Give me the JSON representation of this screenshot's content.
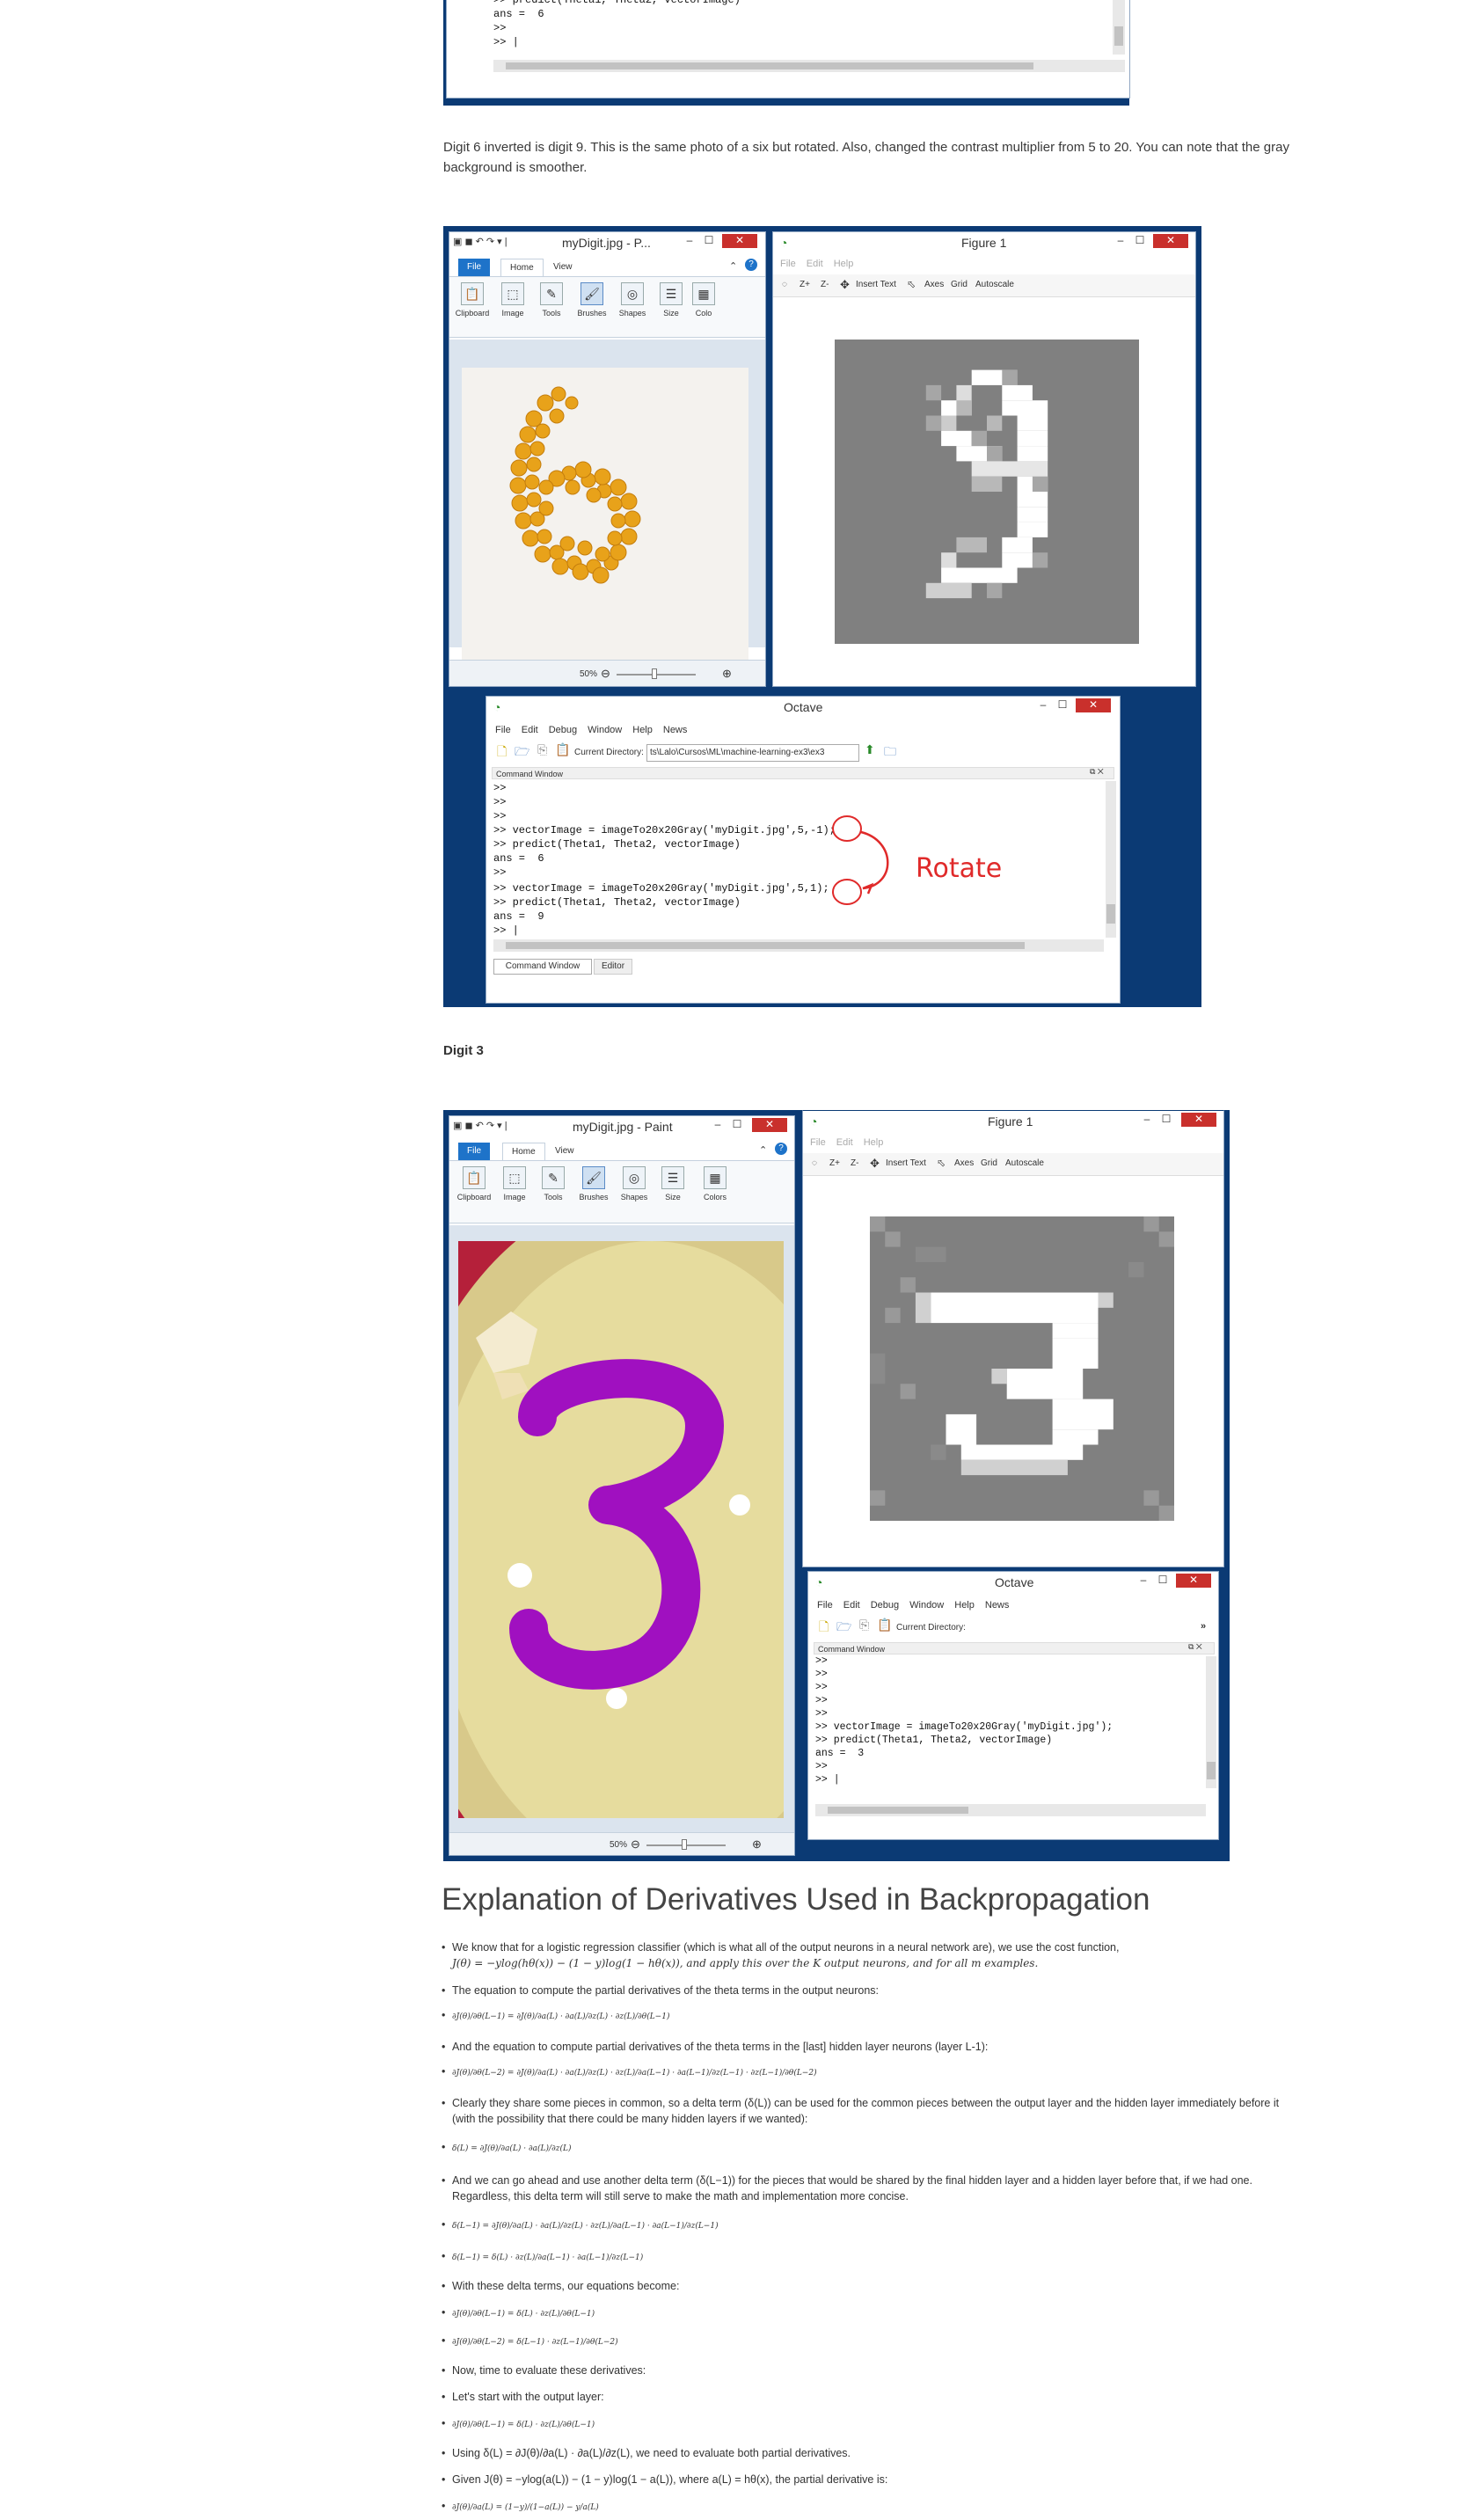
{
  "top_cmd": {
    "lines": [
      ">> predict(Theta1, Theta2, vectorImage)",
      "ans =  6",
      ">>",
      ">> |"
    ]
  },
  "caption_inverted": "Digit 6 inverted is digit 9. This is the same photo of a six but rotated. Also, changed the contrast multiplier from 5 to 20. You can note that the gray background is smoother.",
  "paint1": {
    "title": "myDigit.jpg - P...",
    "tabs": [
      "File",
      "Home",
      "View"
    ],
    "groups": [
      "Clipboard",
      "Image",
      "Tools",
      "Brushes",
      "Shapes",
      "Size",
      "Colo"
    ],
    "zoom": "50%"
  },
  "figure1": {
    "title": "Figure 1",
    "menu": [
      "File",
      "Edit",
      "Help"
    ],
    "tools": [
      "Z+",
      "Z-",
      "Insert Text",
      "Axes",
      "Grid",
      "Autoscale"
    ]
  },
  "octave1": {
    "title": "Octave",
    "menu": [
      "File",
      "Edit",
      "Debug",
      "Window",
      "Help",
      "News"
    ],
    "dir_label": "Current Directory:",
    "dir_value": "ts\\Lalo\\Cursos\\ML\\machine-learning-ex3\\ex3",
    "panel": "Command Window",
    "lines": [
      ">>",
      ">>",
      ">>",
      ">> vectorImage = imageTo20x20Gray('myDigit.jpg',5,-1);",
      ">> predict(Theta1, Theta2, vectorImage)",
      "ans =  6",
      ">>",
      ">> vectorImage = imageTo20x20Gray('myDigit.jpg',5,1);",
      ">> predict(Theta1, Theta2, vectorImage)",
      "ans =  9",
      ">> |"
    ],
    "bottom_tabs": [
      "Command Window",
      "Editor"
    ],
    "annotation": "Rotate",
    "annotation_color": "#e02a2a"
  },
  "digit3_heading": "Digit 3",
  "paint2": {
    "title": "myDigit.jpg - Paint",
    "tabs": [
      "File",
      "Home",
      "View"
    ],
    "groups": [
      "Clipboard",
      "Image",
      "Tools",
      "Brushes",
      "Shapes",
      "Size",
      "Colors"
    ],
    "zoom": "50%",
    "stroke_color": "#a010c0"
  },
  "figure2": {
    "title": "Figure 1",
    "menu": [
      "File",
      "Edit",
      "Help"
    ],
    "tools": [
      "Z+",
      "Z-",
      "Insert Text",
      "Axes",
      "Grid",
      "Autoscale"
    ]
  },
  "octave2": {
    "title": "Octave",
    "menu": [
      "File",
      "Edit",
      "Debug",
      "Window",
      "Help",
      "News"
    ],
    "dir_label": "Current Directory:",
    "panel": "Command Window",
    "lines": [
      ">>",
      ">>",
      ">>",
      ">>",
      ">>",
      ">> vectorImage = imageTo20x20Gray('myDigit.jpg');",
      ">> predict(Theta1, Theta2, vectorImage)",
      "ans =  3",
      ">>",
      ">> |"
    ]
  },
  "section_title": "Explanation of Derivatives Used in Backpropagation",
  "bullets": [
    "We know that for a logistic regression classifier (which is what all of the output neurons in a neural network are), we use the cost function,",
    "J(θ) = −ylog(hθ(x)) − (1 − y)log(1 − hθ(x)), and apply this over the K output neurons, and for all m examples.",
    "The equation to compute the partial derivatives of the theta terms in the output neurons:",
    "∂J(θ)/∂θ(L−1) = ∂J(θ)/∂a(L) · ∂a(L)/∂z(L) · ∂z(L)/∂θ(L−1)",
    "And the equation to compute partial derivatives of the theta terms in the [last] hidden layer neurons (layer L-1):",
    "∂J(θ)/∂θ(L−2) = ∂J(θ)/∂a(L) · ∂a(L)/∂z(L) · ∂z(L)/∂a(L−1) · ∂a(L−1)/∂z(L−1) · ∂z(L−1)/∂θ(L−2)",
    "Clearly they share some pieces in common, so a delta term (δ(L)) can be used for the common pieces between the output layer and the hidden layer immediately before it (with the possibility that there could be many hidden layers if we wanted):",
    "δ(L) = ∂J(θ)/∂a(L) · ∂a(L)/∂z(L)",
    "And we can go ahead and use another delta term (δ(L−1)) for the pieces that would be shared by the final hidden layer and a hidden layer before that, if we had one. Regardless, this delta term will still serve to make the math and implementation more concise.",
    "δ(L−1) = ∂J(θ)/∂a(L) · ∂a(L)/∂z(L) · ∂z(L)/∂a(L−1) · ∂a(L−1)/∂z(L−1)",
    "δ(L−1) = δ(L) · ∂z(L)/∂a(L−1) · ∂a(L−1)/∂z(L−1)",
    "With these delta terms, our equations become:",
    "∂J(θ)/∂θ(L−1) = δ(L) · ∂z(L)/∂θ(L−1)",
    "∂J(θ)/∂θ(L−2) = δ(L−1) · ∂z(L−1)/∂θ(L−2)",
    "Now, time to evaluate these derivatives:",
    "Let's start with the output layer:",
    "∂J(θ)/∂θ(L−1) = δ(L) · ∂z(L)/∂θ(L−1)",
    "Using δ(L) = ∂J(θ)/∂a(L) · ∂a(L)/∂z(L), we need to evaluate both partial derivatives.",
    "Given J(θ) = −ylog(a(L)) − (1 − y)log(1 − a(L)), where a(L) = hθ(x), the partial derivative is:",
    "∂J(θ)/∂a(L) = (1−y)/(1−a(L)) − y/a(L)"
  ]
}
